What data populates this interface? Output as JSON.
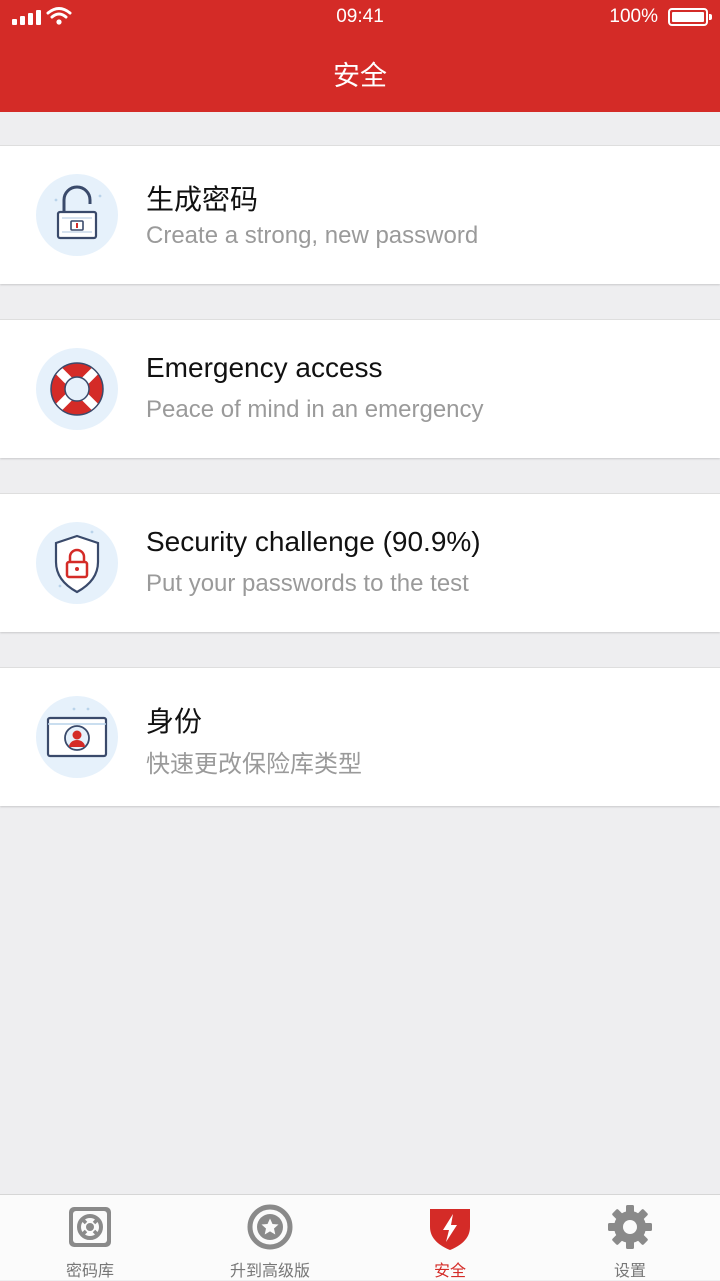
{
  "status_bar": {
    "time": "09:41",
    "battery": "100%"
  },
  "header": {
    "title": "安全"
  },
  "items": [
    {
      "title": "生成密码",
      "subtitle": "Create a strong, new password",
      "icon": "padlock-icon"
    },
    {
      "title": "Emergency access",
      "subtitle": "Peace of mind in an emergency",
      "icon": "lifebuoy-icon"
    },
    {
      "title": "Security challenge (90.9%)",
      "subtitle": "Put your passwords to the test",
      "icon": "shield-lock-icon"
    },
    {
      "title": "身份",
      "subtitle": "快速更改保险库类型",
      "icon": "identity-card-icon"
    }
  ],
  "tabs": [
    {
      "label": "密码库",
      "icon": "vault-icon",
      "active": false
    },
    {
      "label": "升到高级版",
      "icon": "star-icon",
      "active": false
    },
    {
      "label": "安全",
      "icon": "lightning-shield-icon",
      "active": true
    },
    {
      "label": "设置",
      "icon": "gear-icon",
      "active": false
    }
  ],
  "colors": {
    "accent": "#d42b27",
    "background": "#eeeef0",
    "icon_bg": "#e6f1fb"
  }
}
